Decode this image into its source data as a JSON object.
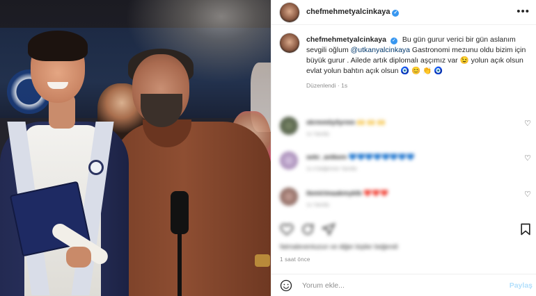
{
  "post": {
    "username": "chefmehmetyalcinkaya",
    "verified_icon": "verified-badge-icon",
    "more_icon": "more-horizontal-icon",
    "caption": {
      "username": "chefmehmetyalcinkaya",
      "text_part1": "Bu gün gurur verici bir gün aslanım sevgili oğlum",
      "mention": "@utkanyalcinkaya",
      "text_part2": "Gastronomi mezunu oldu bizim için büyük gurur . Ailede artık diplomalı aşçımız var 😉 yolun açık olsun evlat yolun bahtın açık olsun 🧿 😊 👏 🧿"
    },
    "edited_label": "Düzenlendi",
    "edited_time": "1s"
  },
  "comments": [
    {
      "username": "skrmmiiyilyrmn",
      "text": "🙌 🙌 🙌",
      "sub": "1s   Yanıtla"
    },
    {
      "username": "sekr_antkem",
      "text": "💙💙💙💙💙💙💙💙",
      "sub": "1s   4 beğenme   Yanıtla"
    },
    {
      "username": "ilemirimaakmyklb",
      "text": "❤️❤️❤️",
      "sub": "1s   Yanıtla"
    }
  ],
  "actions": {
    "like_icon": "heart-icon",
    "comment_icon": "comment-icon",
    "share_icon": "share-icon",
    "save_icon": "bookmark-icon"
  },
  "likes_text": "fatmaleventuzun ve diğer kişiler beğendi",
  "time_ago": "1 saat önce",
  "comment_bar": {
    "emoji_icon": "emoji-icon",
    "placeholder": "Yorum ekle...",
    "post_label": "Paylaş"
  },
  "colors": {
    "accent": "#3897f0",
    "post_button": "#b2dffc",
    "mention": "#00376b"
  }
}
